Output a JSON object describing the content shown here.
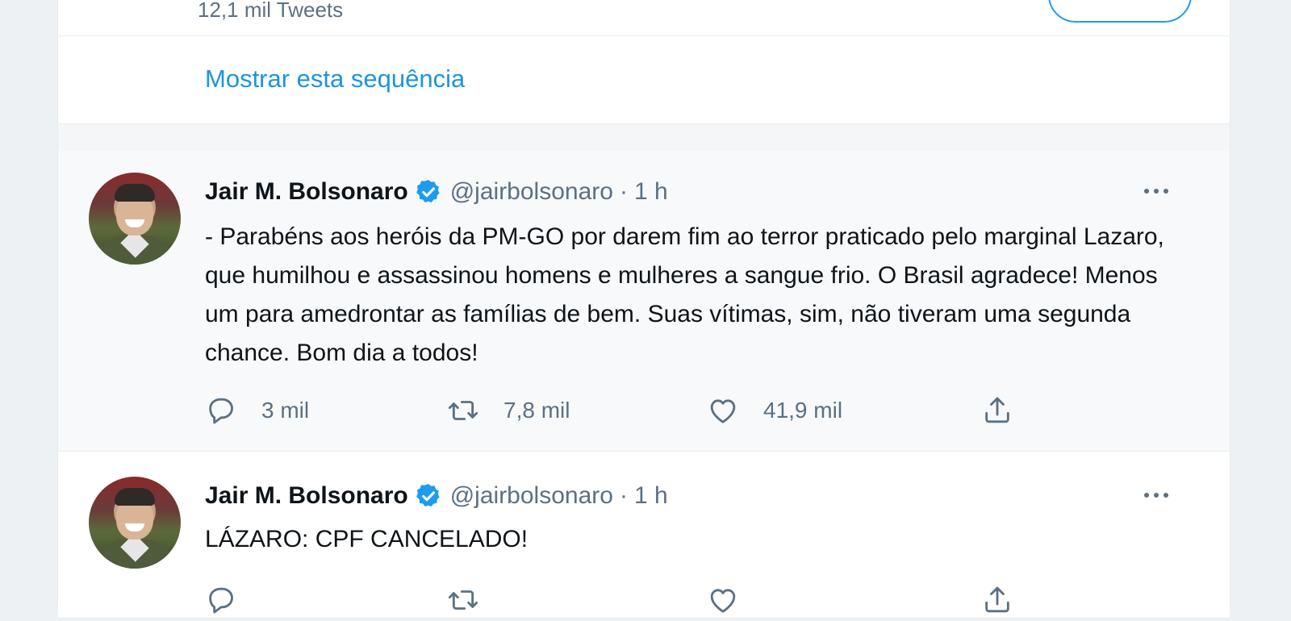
{
  "profile_card": {
    "tweet_count": "12,1 mil Tweets"
  },
  "thread_link": {
    "label": "Mostrar esta sequência"
  },
  "tweets": [
    {
      "display_name": "Jair M. Bolsonaro",
      "verified": true,
      "handle": "@jairbolsonaro",
      "separator": "·",
      "time": "1 h",
      "text": "- Parabéns aos heróis da PM-GO por darem fim ao terror praticado pelo marginal Lazaro, que humilhou e assassinou homens e mulheres a sangue frio. O Brasil agradece! Menos um para amedrontar as famílias de bem. Suas vítimas, sim, não tiveram uma segunda chance. Bom dia a todos!",
      "replies": "3 mil",
      "retweets": "7,8 mil",
      "likes": "41,9 mil"
    },
    {
      "display_name": "Jair M. Bolsonaro",
      "verified": true,
      "handle": "@jairbolsonaro",
      "separator": "·",
      "time": "1 h",
      "text": "LÁZARO: CPF CANCELADO!",
      "replies": "",
      "retweets": "",
      "likes": ""
    }
  ],
  "icons": {
    "reply": "reply-icon",
    "retweet": "retweet-icon",
    "like": "heart-icon",
    "share": "share-icon",
    "more": "more-horizontal-icon",
    "verified": "verified-badge-icon"
  },
  "colors": {
    "accent": "#1d9bf0",
    "link": "#1b95e0",
    "muted": "#5b7083",
    "text": "#0f1419"
  }
}
